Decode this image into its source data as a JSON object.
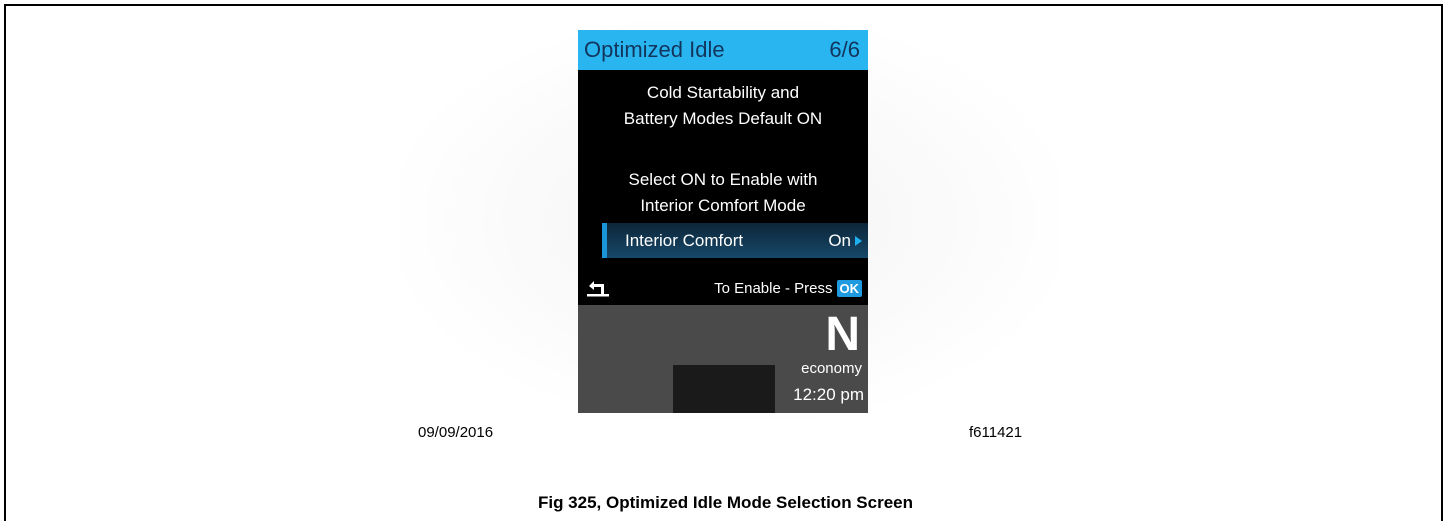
{
  "display": {
    "header": {
      "title": "Optimized Idle",
      "page": "6/6",
      "background_color": "#29b6f0"
    },
    "message1": {
      "line1": "Cold Startability and",
      "line2": "Battery Modes Default ON"
    },
    "message2": {
      "line1": "Select ON to Enable with",
      "line2": "Interior Comfort Mode"
    },
    "selector": {
      "label": "Interior Comfort",
      "value": "On",
      "arrow_icon": "triangle-right-icon"
    },
    "footer": {
      "back_icon": "back-arrow-icon",
      "enable_text": "To Enable - Press",
      "ok_label": "OK"
    },
    "status": {
      "gear": "N",
      "mode": "economy",
      "time": "12:20 pm"
    }
  },
  "figure": {
    "date": "09/09/2016",
    "code": "f611421",
    "caption": "Fig 325, Optimized Idle Mode Selection Screen"
  }
}
